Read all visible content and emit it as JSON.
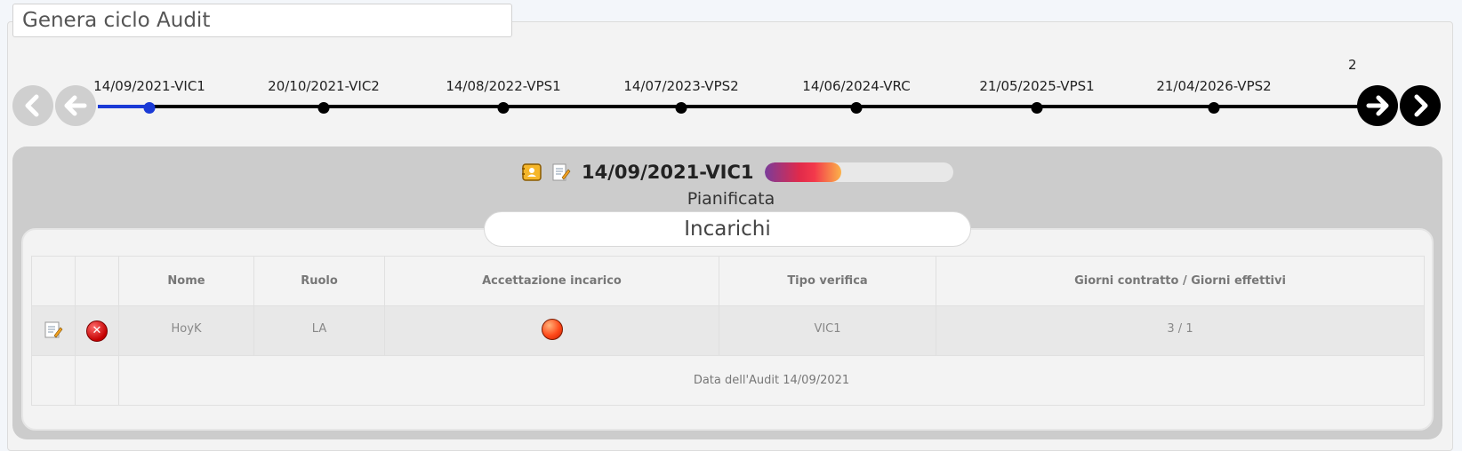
{
  "header": {
    "title": "Genera ciclo Audit"
  },
  "timeline": {
    "items": [
      {
        "label": "14/09/2021-VIC1",
        "current": true
      },
      {
        "label": "20/10/2021-VIC2",
        "current": false
      },
      {
        "label": "14/08/2022-VPS1",
        "current": false
      },
      {
        "label": "14/07/2023-VPS2",
        "current": false
      },
      {
        "label": "14/06/2024-VRC",
        "current": false
      },
      {
        "label": "21/05/2025-VPS1",
        "current": false
      },
      {
        "label": "21/04/2026-VPS2",
        "current": false
      }
    ],
    "more_label": "2",
    "prev_icons": [
      "chevron-left-icon",
      "arrow-left-icon"
    ],
    "next_icons": [
      "arrow-right-icon",
      "chevron-right-icon"
    ]
  },
  "detail": {
    "title": "14/09/2021-VIC1",
    "status": "Pianificata",
    "progress_fraction": 0.41,
    "icons": [
      "contact-card-icon",
      "notepad-icon"
    ]
  },
  "section": {
    "title": "Incarichi"
  },
  "table": {
    "headers": [
      "",
      "",
      "Nome",
      "Ruolo",
      "Accettazione incarico",
      "Tipo verifica",
      "Giorni contratto / Giorni effettivi"
    ],
    "rows": [
      {
        "nome": "HoyK",
        "ruolo": "LA",
        "accettazione_status": "red",
        "tipo": "VIC1",
        "giorni": "3 / 1"
      }
    ],
    "footer": "Data dell'Audit 14/09/2021"
  },
  "colors": {
    "timeline_current": "#1a3ad6",
    "status_ball": "#ff4a1a",
    "delete_icon": "#c40000"
  }
}
